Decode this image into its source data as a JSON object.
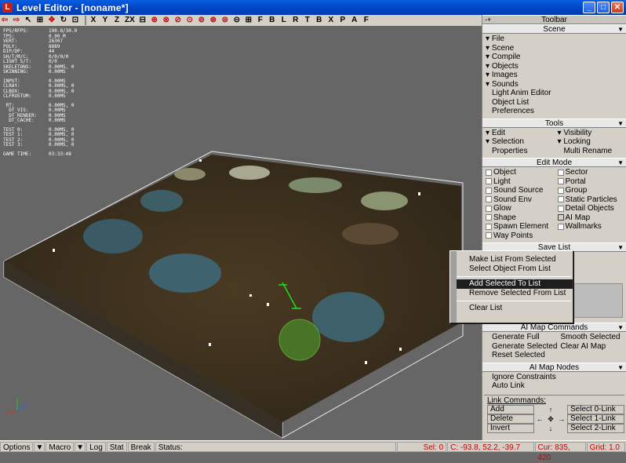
{
  "window": {
    "title": "Level Editor - [noname*]",
    "app_icon": "L",
    "buttons": [
      "_",
      "□",
      "✕"
    ]
  },
  "toolbar": {
    "items": [
      "⇦",
      "⇨",
      "↖",
      "⊞",
      "✥",
      "↻",
      "⊡",
      "X",
      "Y",
      "Z",
      "ZX",
      "⊟",
      "⊕",
      "⊗",
      "⊘",
      "⊙",
      "⊚",
      "⊛",
      "⊜",
      "⊝",
      "⊞",
      "F",
      "B",
      "L",
      "R",
      "T",
      "B",
      "X",
      "P",
      "A",
      "F"
    ],
    "groups_hint": "icon-toolbar"
  },
  "stats": [
    {
      "k": "FPS/RFPS:",
      "v": "190.8/30.0"
    },
    {
      "k": "TPS:",
      "v": "0.00 M"
    },
    {
      "k": "VERT:",
      "v": "26307"
    },
    {
      "k": "POLY:",
      "v": "8889"
    },
    {
      "k": "DIP/DP:",
      "v": "44"
    },
    {
      "k": "SH/T/M/C:",
      "v": "0/0/0/0"
    },
    {
      "k": "LIGHT S/T:",
      "v": "0/0"
    },
    {
      "k": "SKELETONS:",
      "v": "0.00MS, 0"
    },
    {
      "k": "SKINNING:",
      "v": "0.00MS"
    },
    {
      "k": "",
      "v": ""
    },
    {
      "k": "INPUT:",
      "v": "0.00MS"
    },
    {
      "k": "CLRAY:",
      "v": "0.00MS, 0"
    },
    {
      "k": "CLBOX:",
      "v": "0.00MS, 0"
    },
    {
      "k": "CLFRUSTUM:",
      "v": "0.00MS"
    },
    {
      "k": "",
      "v": ""
    },
    {
      "k": " RT:",
      "v": "0.00MS, 0"
    },
    {
      "k": "  DT_VIS:",
      "v": "0.00MS"
    },
    {
      "k": "  DT_RENDER:",
      "v": "0.00MS"
    },
    {
      "k": "  DT_CACHE:",
      "v": "0.00MS"
    },
    {
      "k": "",
      "v": ""
    },
    {
      "k": "TEST 0:",
      "v": "0.00MS, 0"
    },
    {
      "k": "TEST 1:",
      "v": "0.00MS, 0"
    },
    {
      "k": "TEST 2:",
      "v": "0.00MS, 0"
    },
    {
      "k": "TEST 3:",
      "v": "0.00MS, 0"
    },
    {
      "k": "",
      "v": ""
    },
    {
      "k": "GAME TIME:",
      "v": "03:33:48"
    }
  ],
  "panel": {
    "toolbar_header": "Toolbar",
    "toolbar_minus": "-+",
    "scene": {
      "header": "Scene",
      "items": [
        "File",
        "Scene",
        "Compile",
        "Objects",
        "Images",
        "Sounds"
      ],
      "plain": [
        "Light Anim Editor",
        "Object List",
        "Preferences"
      ]
    },
    "tools": {
      "header": "Tools",
      "left": [
        "Edit",
        "Selection",
        "Properties"
      ],
      "right": [
        "Visibility",
        "Locking",
        "Multi Rename"
      ]
    },
    "edit_mode": {
      "header": "Edit Mode",
      "left": [
        "Object",
        "Light",
        "Sound Source",
        "Sound Env",
        "Glow",
        "Shape",
        "Spawn Element",
        "Way Points"
      ],
      "right": [
        "Sector",
        "Portal",
        "Group",
        "Static Particles",
        "Detail Objects",
        "AI Map",
        "Wallmarks"
      ]
    },
    "save_list": {
      "header": "Save List"
    },
    "ai_commands": {
      "header": "AI Map Commands",
      "left": [
        "Generate Full",
        "Generate Selected",
        "Reset Selected"
      ],
      "right": [
        "Smooth Selected",
        "Clear AI Map",
        ""
      ]
    },
    "ai_nodes": {
      "header": "AI Map Nodes",
      "items": [
        "Ignore Constraints",
        "Auto Link"
      ]
    },
    "link": {
      "title": "Link Commands:",
      "left": [
        "Add",
        "Delete",
        "Invert"
      ],
      "arrows": [
        "↑",
        "←",
        "✥",
        "→",
        "↓"
      ],
      "right": [
        "Select 0-Link",
        "Select 1-Link",
        "Select 2-Link"
      ]
    }
  },
  "context_menu": {
    "items": [
      "Make List From Selected",
      "Select Object From List",
      "Add Selected To List",
      "Remove Selected From List",
      "Clear List"
    ],
    "highlighted": 2
  },
  "statusbar": {
    "options": "Options",
    "macro": "Macro",
    "log": "Log",
    "stat": "Stat",
    "break": "Break",
    "status": "Status:",
    "sel": "Sel: 0",
    "coord": "C: -93.8, 52.2, -39.7",
    "cur": "Cur: 835, 420",
    "grid": "Grid: 1.0"
  },
  "colors": {
    "accent": "#0a5ee0",
    "panel": "#d4d0c8",
    "viewport": "#666666",
    "status_red": "#c00000"
  }
}
